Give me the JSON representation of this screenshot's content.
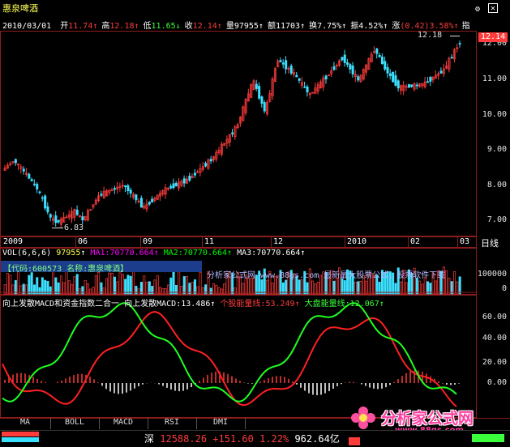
{
  "header": {
    "stock_name": "惠泉啤酒",
    "date": "2010/03/01",
    "quote": [
      {
        "label": "开",
        "value": "11.74",
        "arrow": "↑",
        "color": "#ff3c3c"
      },
      {
        "label": "高",
        "value": "12.18",
        "arrow": "↑",
        "color": "#ff3c3c"
      },
      {
        "label": "低",
        "value": "11.65",
        "arrow": "↓",
        "color": "#3cff3c"
      },
      {
        "label": "收",
        "value": "12.14",
        "arrow": "↑",
        "color": "#ff3c3c"
      },
      {
        "label": "量",
        "value": "97955",
        "arrow": "↑",
        "color": "#ffffff"
      },
      {
        "label": "额",
        "value": "11703",
        "arrow": "↑",
        "color": "#ffffff"
      },
      {
        "label": "换",
        "value": "7.75%",
        "arrow": "↑",
        "color": "#ffffff"
      },
      {
        "label": "振",
        "value": "4.52%",
        "arrow": "↑",
        "color": "#ffffff"
      },
      {
        "label": "涨",
        "value": "(0.42)3.58%",
        "arrow": "↑",
        "color": "#ff3c3c"
      }
    ],
    "overflow_char": "指"
  },
  "price_chart": {
    "high_marker": "12.18",
    "low_marker": "6.83",
    "current_price": "12.14",
    "y_ticks": [
      "12.00",
      "11.00",
      "10.00",
      "9.00",
      "8.00",
      "7.00"
    ]
  },
  "time_axis": {
    "labels": [
      "2009",
      "06",
      "09",
      "11",
      "12",
      "2010",
      "02",
      "03"
    ],
    "period": "日线"
  },
  "volume": {
    "title": "VOL(6,6,6)",
    "vol_value": "97955",
    "ma1": "MA1:70770.664",
    "ma2": "MA2:70770.664",
    "ma3": "MA3:70770.664",
    "info_text": "【代码:600573 名称:惠泉啤酒】",
    "watermark": "分析家公式网 www.88gs.com 最新最大股票公式，股票软件下载",
    "y_ticks": [
      "100000",
      "0"
    ]
  },
  "indicator": {
    "title": "向上发散MACD和资金指数二合一",
    "sub_name": "向上发散MACD:",
    "sub_value": "13.486",
    "gege_label": "个股能量线:",
    "gege_value": "53.249",
    "dapan_label": "大盘能量线:",
    "dapan_value": "12.067",
    "y_ticks": [
      "60.00",
      "40.00",
      "20.00",
      "0.00"
    ]
  },
  "tabs": [
    "MA",
    "BOLL",
    "MACD",
    "RSI",
    "DMI"
  ],
  "status_bar": {
    "market": "深",
    "index": "12588.26",
    "change": "+151.60",
    "pct": "1.22%",
    "amount": "962.64亿"
  },
  "logo": {
    "text": "分析家公式网",
    "url": "www.88gs.com"
  },
  "colors": {
    "up": "#ff3c3c",
    "down": "#3ce0ff",
    "green": "#3cff3c",
    "axis": "#8a1c1c",
    "ma1": "#ff00ff",
    "ma2": "#00ff00",
    "ma3": "#ffffff"
  }
}
